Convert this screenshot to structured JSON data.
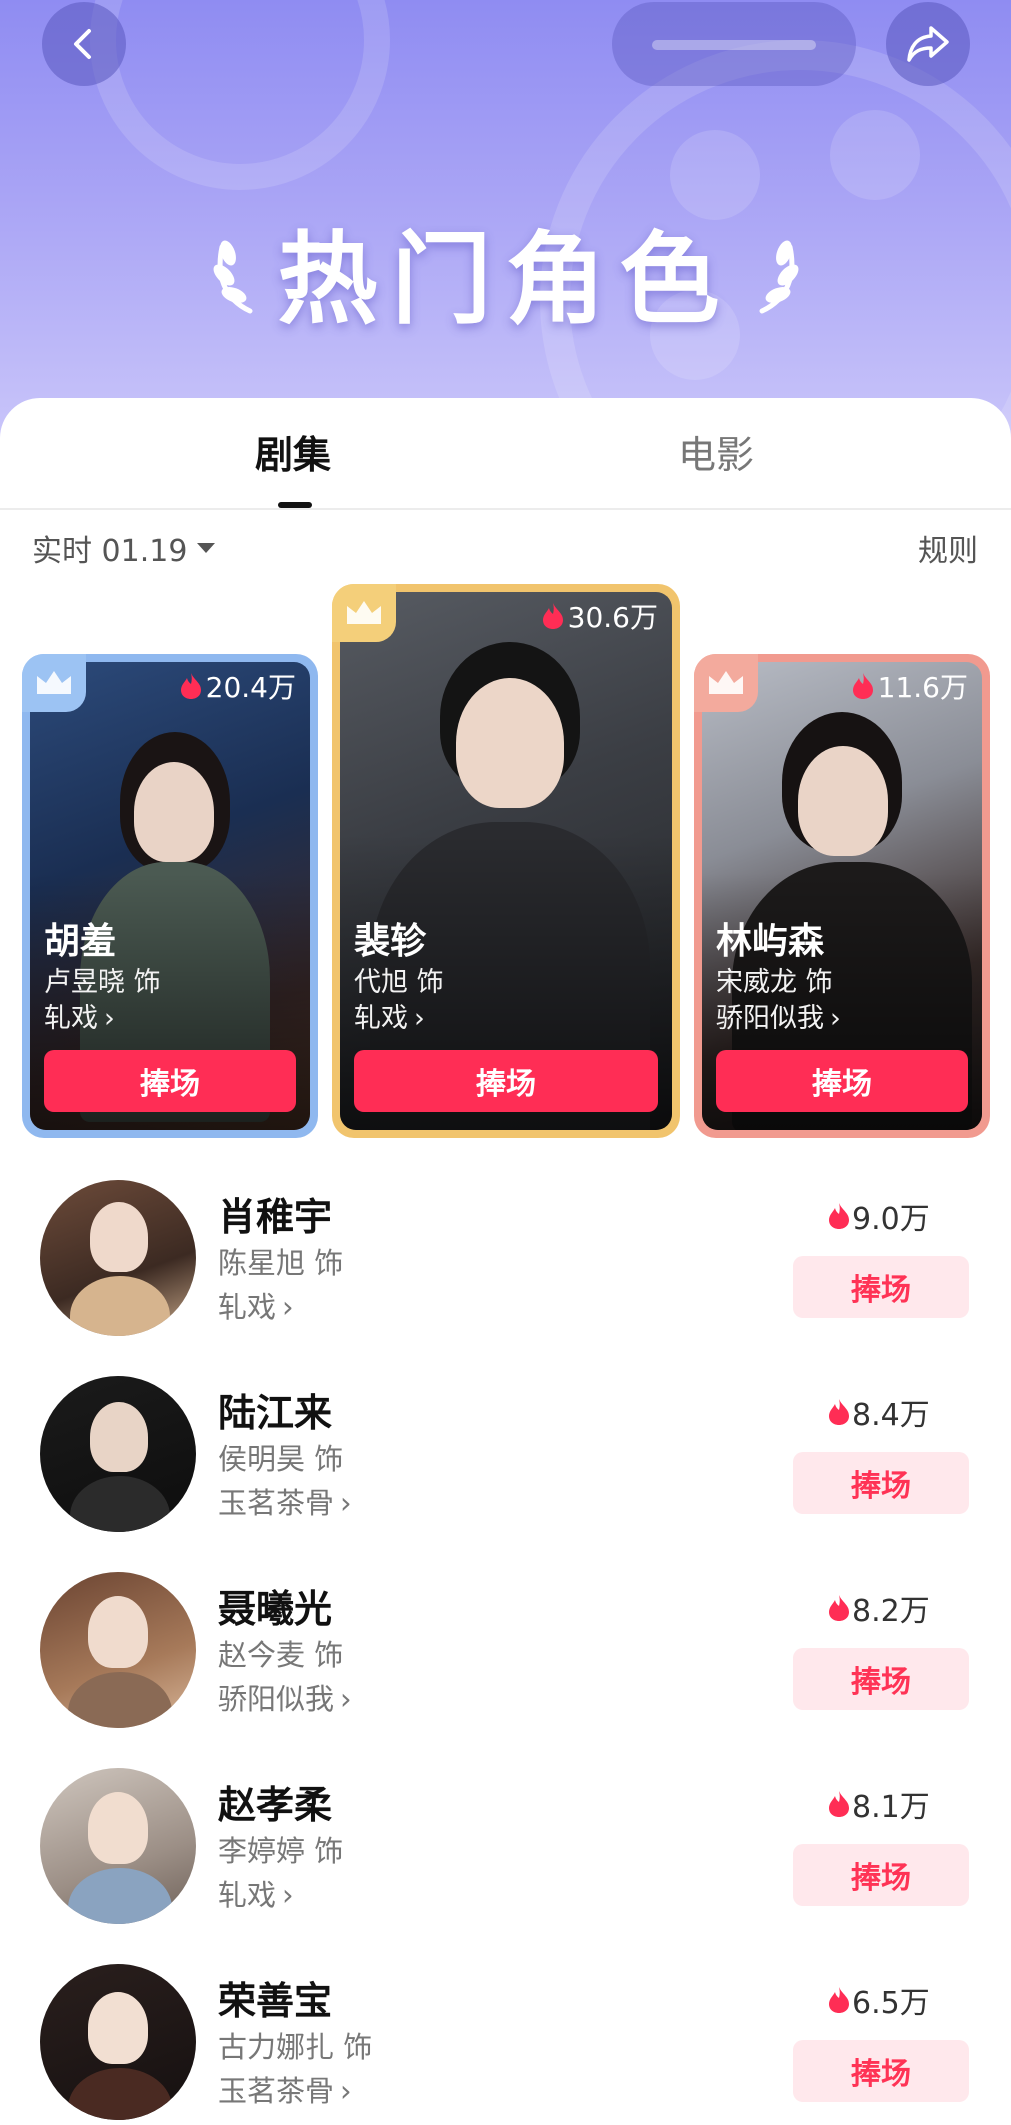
{
  "header": {
    "title": "热门角色"
  },
  "tabs": [
    {
      "label": "剧集",
      "active": true
    },
    {
      "label": "电影",
      "active": false
    }
  ],
  "filter": {
    "label": "实时 01.19",
    "rules": "规则"
  },
  "top3": [
    {
      "name": "胡羞",
      "actor": "卢昱晓 饰",
      "show": "轧戏",
      "heat": "20.4万",
      "button": "捧场",
      "rank": 2
    },
    {
      "name": "裴轸",
      "actor": "代旭 饰",
      "show": "轧戏",
      "heat": "30.6万",
      "button": "捧场",
      "rank": 1
    },
    {
      "name": "林屿森",
      "actor": "宋威龙 饰",
      "show": "骄阳似我",
      "heat": "11.6万",
      "button": "捧场",
      "rank": 3
    }
  ],
  "list": [
    {
      "name": "肖稚宇",
      "actor": "陈星旭 饰",
      "show": "轧戏",
      "heat": "9.0万",
      "button": "捧场"
    },
    {
      "name": "陆江来",
      "actor": "侯明昊 饰",
      "show": "玉茗茶骨",
      "heat": "8.4万",
      "button": "捧场"
    },
    {
      "name": "聂曦光",
      "actor": "赵今麦 饰",
      "show": "骄阳似我",
      "heat": "8.2万",
      "button": "捧场"
    },
    {
      "name": "赵孝柔",
      "actor": "李婷婷 饰",
      "show": "轧戏",
      "heat": "8.1万",
      "button": "捧场"
    },
    {
      "name": "荣善宝",
      "actor": "古力娜扎 饰",
      "show": "玉茗茶骨",
      "heat": "6.5万",
      "button": "捧场"
    }
  ],
  "colors": {
    "accent": "#ff2d55",
    "header_bg": "#a9a4f5",
    "button_soft": "#ffe8ec"
  },
  "icons": [
    "back-arrow-icon",
    "share-icon",
    "laurel-icon",
    "caret-down-icon",
    "crown-icon",
    "flame-icon",
    "chevron-right-icon"
  ]
}
